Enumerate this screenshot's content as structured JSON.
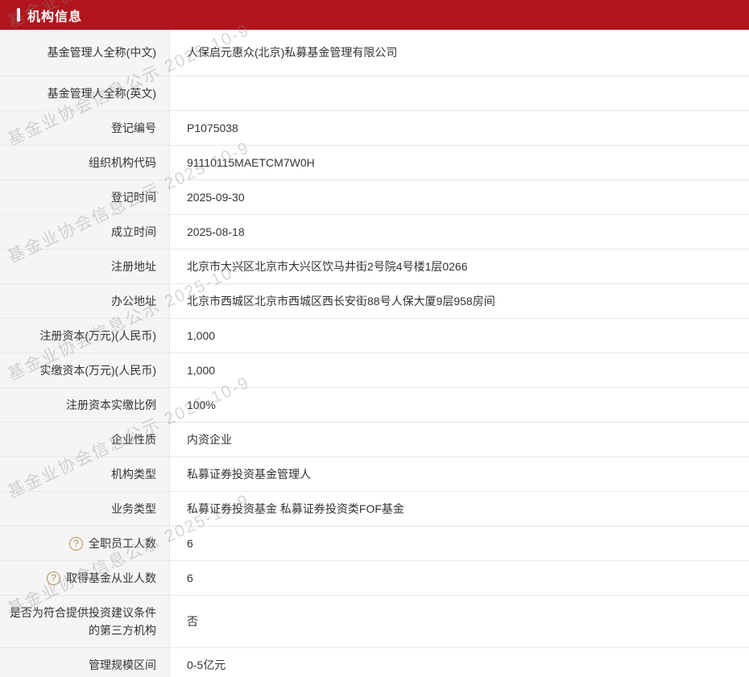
{
  "header": {
    "title": "机构信息"
  },
  "watermark": {
    "text": "基金业协会信息公示 2025-10-9"
  },
  "icons": {
    "help": {
      "name": "question-circle-icon",
      "glyph": "?",
      "color": "#b29158"
    }
  },
  "colors": {
    "accent_red": "#b1151d",
    "label_bg": "#f5f5f6",
    "border": "#e8e8e8",
    "text": "#333333",
    "watermark": "rgba(140,140,140,0.35)"
  },
  "table": {
    "rows": [
      {
        "label": "基金管理人全称(中文)",
        "value": "人保启元惠众(北京)私募基金管理有限公司",
        "help": false,
        "size": "tall"
      },
      {
        "label": "基金管理人全称(英文)",
        "value": "",
        "help": false,
        "size": "normal"
      },
      {
        "label": "登记编号",
        "value": "P1075038",
        "help": false,
        "size": "normal"
      },
      {
        "label": "组织机构代码",
        "value": "91110115MAETCM7W0H",
        "help": false,
        "size": "normal"
      },
      {
        "label": "登记时间",
        "value": "2025-09-30",
        "help": false,
        "size": "normal"
      },
      {
        "label": "成立时间",
        "value": "2025-08-18",
        "help": false,
        "size": "normal"
      },
      {
        "label": "注册地址",
        "value": "北京市大兴区北京市大兴区饮马井街2号院4号楼1层0266",
        "help": false,
        "size": "normal"
      },
      {
        "label": "办公地址",
        "value": "北京市西城区北京市西城区西长安街88号人保大厦9层958房间",
        "help": false,
        "size": "normal"
      },
      {
        "label": "注册资本(万元)(人民币)",
        "value": "1,000",
        "help": false,
        "size": "normal"
      },
      {
        "label": "实缴资本(万元)(人民币)",
        "value": "1,000",
        "help": false,
        "size": "normal"
      },
      {
        "label": "注册资本实缴比例",
        "value": "100%",
        "help": false,
        "size": "normal"
      },
      {
        "label": "企业性质",
        "value": "内资企业",
        "help": false,
        "size": "normal"
      },
      {
        "label": "机构类型",
        "value": "私募证券投资基金管理人",
        "help": false,
        "size": "normal"
      },
      {
        "label": "业务类型",
        "value": "私募证券投资基金 私募证券投资类FOF基金",
        "help": false,
        "size": "normal"
      },
      {
        "label": "全职员工人数",
        "value": "6",
        "help": true,
        "size": "normal"
      },
      {
        "label": "取得基金从业人数",
        "value": "6",
        "help": true,
        "size": "normal"
      },
      {
        "label": "是否为符合提供投资建议条件的第三方机构",
        "value": "否",
        "help": false,
        "size": "xtall"
      },
      {
        "label": "管理规模区间",
        "value": "0-5亿元",
        "help": false,
        "size": "normal"
      }
    ]
  },
  "watermark_layout": {
    "tops": [
      14,
      160,
      306,
      452,
      598,
      744
    ]
  }
}
